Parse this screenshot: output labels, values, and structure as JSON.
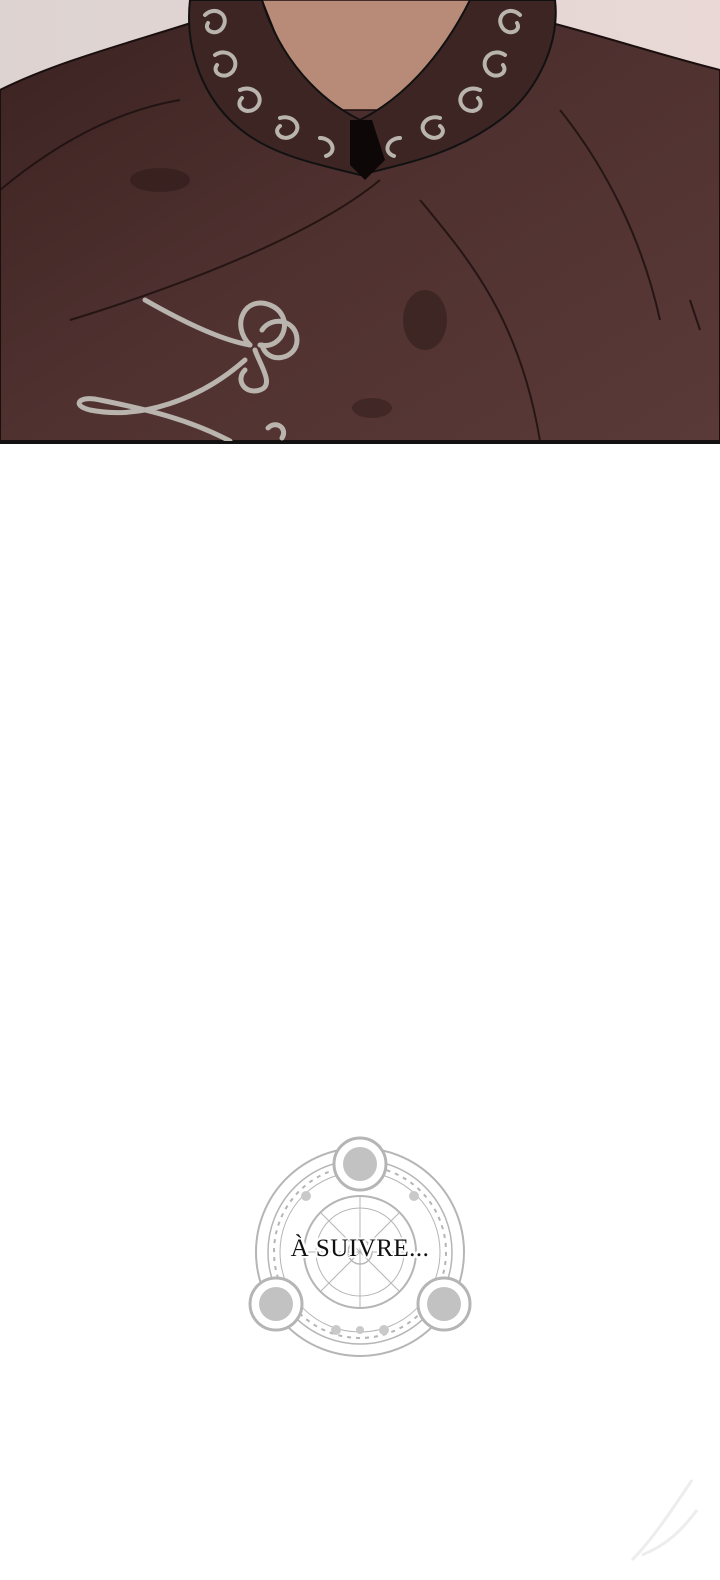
{
  "panel": {
    "description_colors": {
      "coat": "#4a2e2b",
      "coat_shadow": "#2e1b19",
      "embroidery": "#b9b4ad",
      "skin": "#b88a78",
      "background": "#d9cfcc"
    }
  },
  "ending_seal": {
    "label": "À SUIVRE...",
    "color": "#b5b5b5"
  }
}
